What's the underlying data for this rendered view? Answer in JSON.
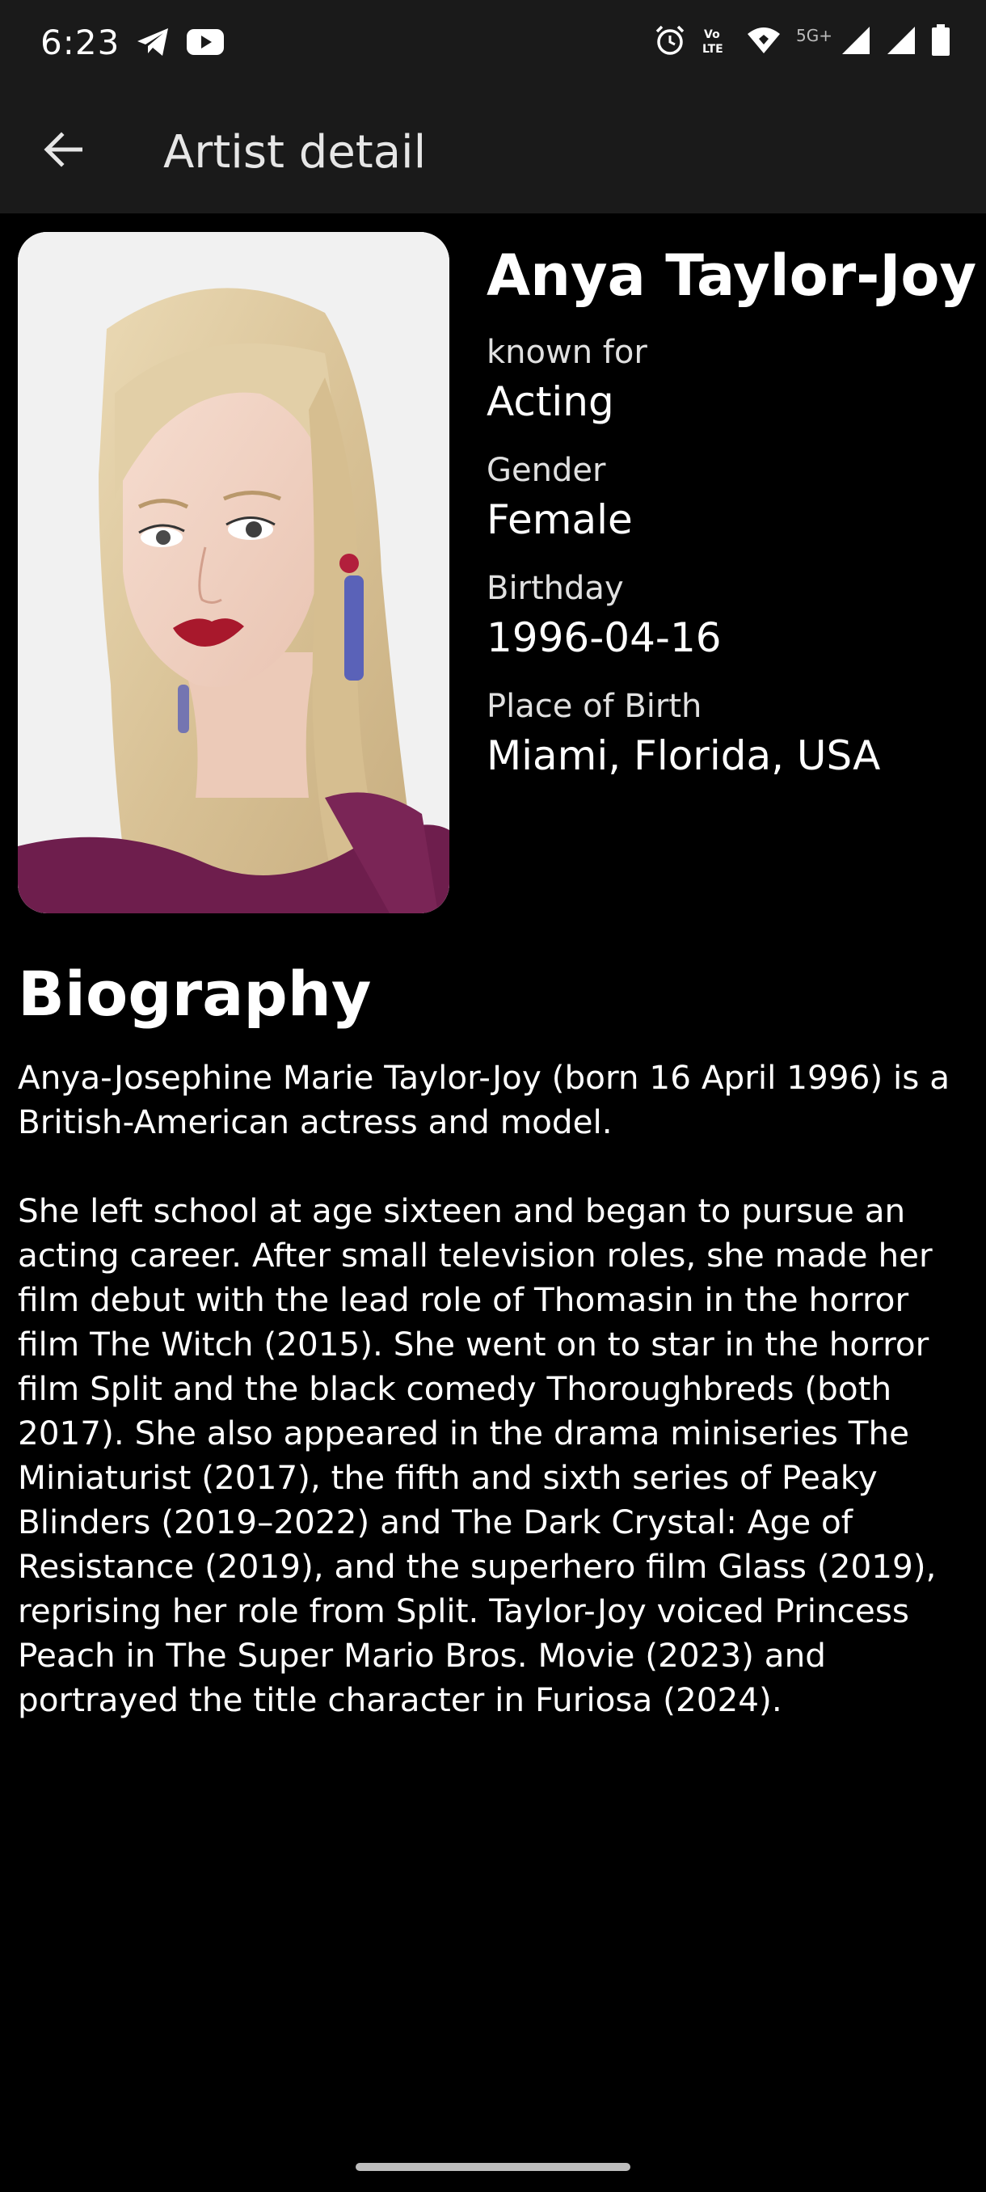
{
  "status_bar": {
    "time": "6:23",
    "network": "5G+",
    "left_icons": [
      "telegram-icon",
      "youtube-icon"
    ],
    "right_icons": [
      "alarm-icon",
      "volte-icon",
      "wifi-icon",
      "signal-icon",
      "signal-icon",
      "battery-icon"
    ]
  },
  "app_bar": {
    "title": "Artist detail",
    "back_icon": "arrow-left-icon"
  },
  "artist": {
    "name": "Anya Taylor-Joy",
    "fields": [
      {
        "label": "known for",
        "value": "Acting"
      },
      {
        "label": "Gender",
        "value": "Female"
      },
      {
        "label": "Birthday",
        "value": "1996-04-16"
      },
      {
        "label": "Place of Birth",
        "value": "Miami, Florida, USA"
      }
    ]
  },
  "biography": {
    "title": "Biography",
    "paragraphs": [
      "Anya-Josephine Marie Taylor-Joy (born 16 April 1996) is a British-American actress and model.",
      "She left school at age sixteen and began to pursue an acting career. After small television roles, she made her film debut with the lead role of Thomasin in the horror film The Witch (2015). She went on to star in the horror film Split and the black comedy Thoroughbreds (both 2017). She also appeared in the drama miniseries The Miniaturist (2017), the fifth and sixth series of Peaky Blinders (2019–2022) and The Dark Crystal: Age of Resistance (2019), and the superhero film Glass (2019), reprising her role from Split. Taylor-Joy voiced Princess Peach in The Super Mario Bros. Movie (2023) and portrayed the title character in Furiosa (2024)."
    ]
  },
  "colors": {
    "background": "#000000",
    "app_bar": "#1a1a1a",
    "text": "#ffffff"
  }
}
